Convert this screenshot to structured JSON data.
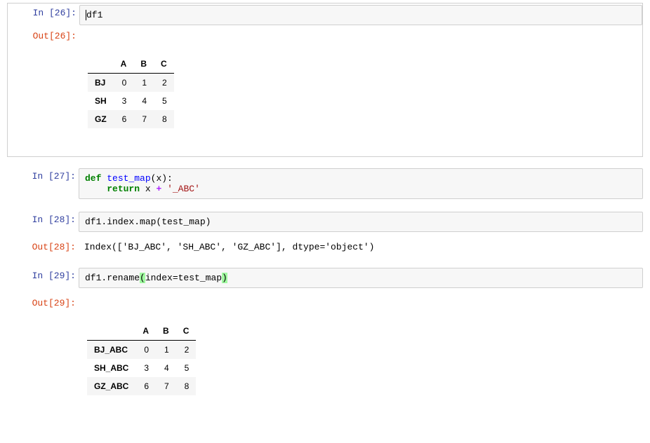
{
  "cells": {
    "c26": {
      "in_prompt": "In  [26]:",
      "out_prompt": "Out[26]:",
      "code": "df1",
      "table": {
        "columns": [
          "A",
          "B",
          "C"
        ],
        "index": [
          "BJ",
          "SH",
          "GZ"
        ],
        "rows": [
          [
            0,
            1,
            2
          ],
          [
            3,
            4,
            5
          ],
          [
            6,
            7,
            8
          ]
        ]
      }
    },
    "c27": {
      "in_prompt": "In  [27]:",
      "code": {
        "kw_def": "def",
        "fn_name": "test_map",
        "sig": "(x):",
        "indent": "    ",
        "kw_return": "return",
        "expr_pre": " x ",
        "op": "+",
        "expr_sp": " ",
        "str": "'_ABC'"
      }
    },
    "c28": {
      "in_prompt": "In  [28]:",
      "out_prompt": "Out[28]:",
      "code": "df1.index.map(test_map)",
      "output": "Index(['BJ_ABC', 'SH_ABC', 'GZ_ABC'], dtype='object')"
    },
    "c29": {
      "in_prompt": "In  [29]:",
      "out_prompt": "Out[29]:",
      "code": {
        "pre": "df1.rename",
        "lparen": "(",
        "args": "index=test_map",
        "rparen": ")"
      },
      "table": {
        "columns": [
          "A",
          "B",
          "C"
        ],
        "index": [
          "BJ_ABC",
          "SH_ABC",
          "GZ_ABC"
        ],
        "rows": [
          [
            0,
            1,
            2
          ],
          [
            3,
            4,
            5
          ],
          [
            6,
            7,
            8
          ]
        ]
      }
    }
  },
  "chart_data": [
    {
      "type": "table",
      "title": "df1",
      "columns": [
        "A",
        "B",
        "C"
      ],
      "index": [
        "BJ",
        "SH",
        "GZ"
      ],
      "values": [
        [
          0,
          1,
          2
        ],
        [
          3,
          4,
          5
        ],
        [
          6,
          7,
          8
        ]
      ]
    },
    {
      "type": "table",
      "title": "df1.rename(index=test_map)",
      "columns": [
        "A",
        "B",
        "C"
      ],
      "index": [
        "BJ_ABC",
        "SH_ABC",
        "GZ_ABC"
      ],
      "values": [
        [
          0,
          1,
          2
        ],
        [
          3,
          4,
          5
        ],
        [
          6,
          7,
          8
        ]
      ]
    }
  ]
}
